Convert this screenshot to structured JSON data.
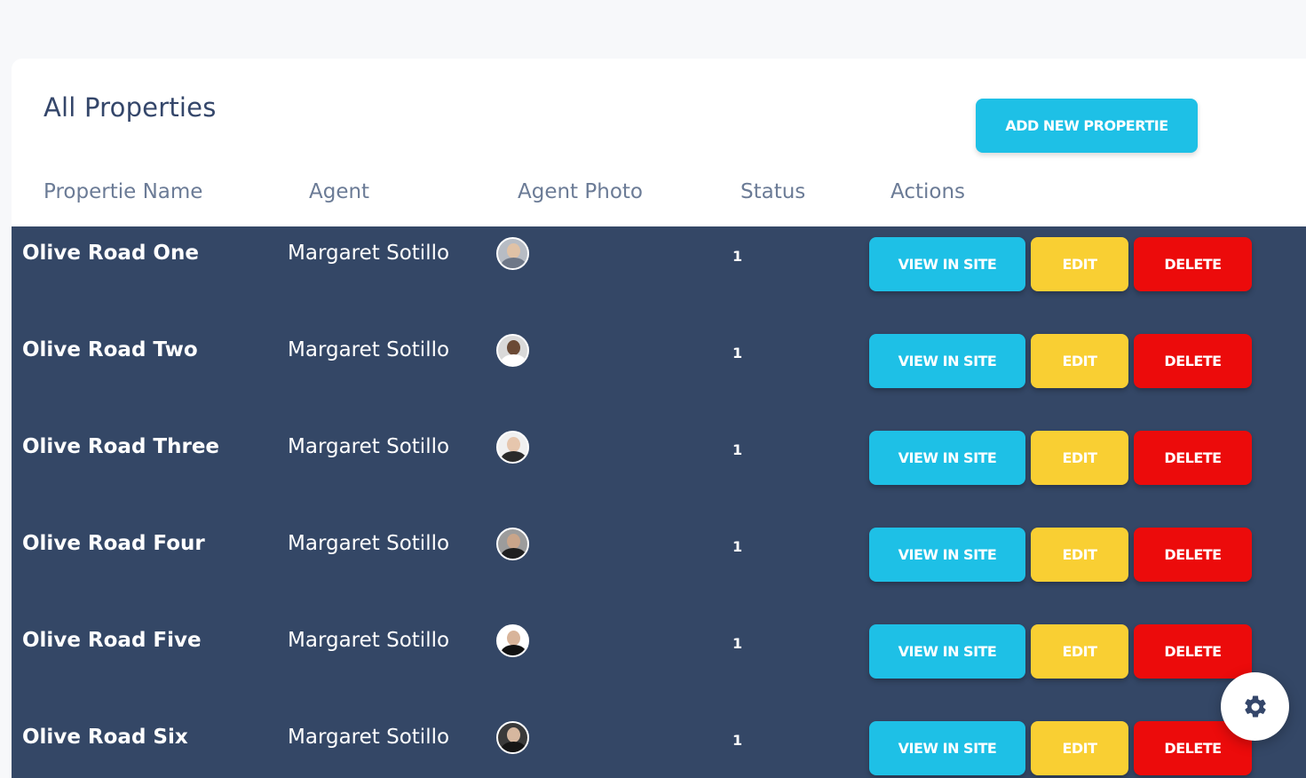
{
  "page": {
    "title": "All Properties",
    "add_button_label": "ADD NEW PROPERTIE"
  },
  "table": {
    "columns": [
      "Propertie Name",
      "Agent",
      "Agent Photo",
      "Status",
      "Actions"
    ],
    "rows": [
      {
        "name": "Olive Road One",
        "agent": "Margaret Sotillo",
        "status": "1",
        "photo_icon": "agent-photo"
      },
      {
        "name": "Olive Road Two",
        "agent": "Margaret Sotillo",
        "status": "1",
        "photo_icon": "agent-photo"
      },
      {
        "name": "Olive Road Three",
        "agent": "Margaret Sotillo",
        "status": "1",
        "photo_icon": "agent-photo"
      },
      {
        "name": "Olive Road Four",
        "agent": "Margaret Sotillo",
        "status": "1",
        "photo_icon": "agent-photo"
      },
      {
        "name": "Olive Road Five",
        "agent": "Margaret Sotillo",
        "status": "1",
        "photo_icon": "agent-photo"
      },
      {
        "name": "Olive Road Six",
        "agent": "Margaret Sotillo",
        "status": "1",
        "photo_icon": "agent-photo"
      }
    ],
    "actions": {
      "view_label": "VIEW IN SITE",
      "edit_label": "EDIT",
      "delete_label": "DELETE"
    }
  },
  "colors": {
    "page_bg": "#f7f8fa",
    "card_bg": "#ffffff",
    "title_text": "#34466a",
    "header_text": "#6b7b96",
    "row_bg": "#344766",
    "primary_cyan": "#1ec0e6",
    "edit_yellow": "#f9cf33",
    "delete_red": "#ec0b0b"
  },
  "floating": {
    "icon": "gear-icon"
  }
}
